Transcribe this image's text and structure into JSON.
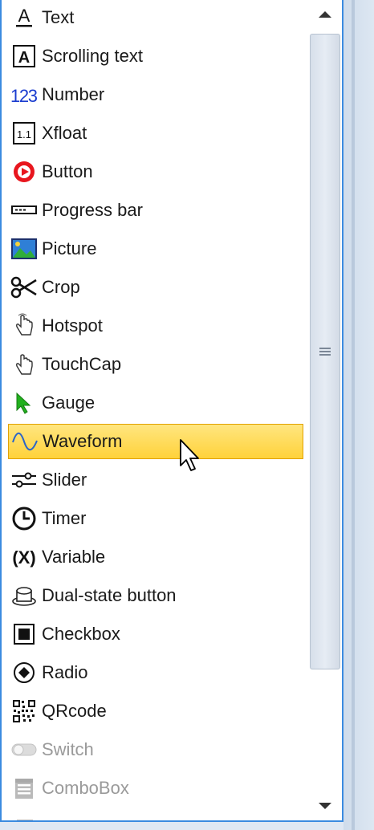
{
  "toolbox": {
    "items": [
      {
        "label": "Text",
        "icon": "text-a-icon",
        "state": "normal"
      },
      {
        "label": "Scrolling text",
        "icon": "scrolling-text-icon",
        "state": "normal"
      },
      {
        "label": "Number",
        "icon": "number-123-icon",
        "state": "normal"
      },
      {
        "label": "Xfloat",
        "icon": "xfloat-icon",
        "state": "normal"
      },
      {
        "label": "Button",
        "icon": "button-play-icon",
        "state": "normal"
      },
      {
        "label": "Progress bar",
        "icon": "progress-bar-icon",
        "state": "normal"
      },
      {
        "label": "Picture",
        "icon": "picture-icon",
        "state": "normal"
      },
      {
        "label": "Crop",
        "icon": "scissors-icon",
        "state": "normal"
      },
      {
        "label": "Hotspot",
        "icon": "hand-pointer-icon",
        "state": "normal"
      },
      {
        "label": "TouchCap",
        "icon": "hand-touch-icon",
        "state": "normal"
      },
      {
        "label": "Gauge",
        "icon": "gauge-pointer-icon",
        "state": "normal"
      },
      {
        "label": "Waveform",
        "icon": "waveform-icon",
        "state": "selected"
      },
      {
        "label": "Slider",
        "icon": "slider-icon",
        "state": "normal"
      },
      {
        "label": "Timer",
        "icon": "clock-icon",
        "state": "normal"
      },
      {
        "label": "Variable",
        "icon": "variable-icon",
        "state": "normal"
      },
      {
        "label": "Dual-state button",
        "icon": "dual-state-button-icon",
        "state": "normal"
      },
      {
        "label": "Checkbox",
        "icon": "checkbox-icon",
        "state": "normal"
      },
      {
        "label": "Radio",
        "icon": "radio-icon",
        "state": "normal"
      },
      {
        "label": "QRcode",
        "icon": "qrcode-icon",
        "state": "normal"
      },
      {
        "label": "Switch",
        "icon": "switch-icon",
        "state": "disabled"
      },
      {
        "label": "ComboBox",
        "icon": "combobox-icon",
        "state": "disabled"
      },
      {
        "label": "",
        "icon": "partial-item-icon",
        "state": "disabled"
      }
    ]
  },
  "colors": {
    "selection_fill": "#ffd23a",
    "selection_border": "#e2a200",
    "panel_border": "#3b8be0",
    "disabled_text": "#9a9a9a"
  }
}
